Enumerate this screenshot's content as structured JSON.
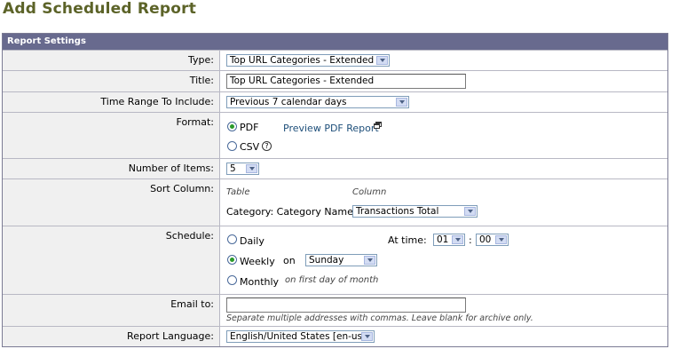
{
  "page": {
    "title": "Add Scheduled Report"
  },
  "panel": {
    "header": "Report Settings"
  },
  "labels": {
    "type": "Type:",
    "title": "Title:",
    "time_range": "Time Range To Include:",
    "format": "Format:",
    "number_of_items": "Number of Items:",
    "sort_column": "Sort Column:",
    "schedule": "Schedule:",
    "email_to": "Email to:",
    "report_language": "Report Language:"
  },
  "type": {
    "selected": "Top URL Categories - Extended"
  },
  "title_field": {
    "value": "Top URL Categories - Extended"
  },
  "time_range": {
    "selected": "Previous 7 calendar days"
  },
  "format": {
    "pdf_label": "PDF",
    "csv_label": "CSV",
    "selected": "PDF",
    "preview_link": "Preview PDF Report",
    "help_glyph": "?"
  },
  "number_of_items": {
    "selected": "5"
  },
  "sort_column": {
    "table_header": "Table",
    "column_header": "Column",
    "row_label": "Category: Category Name",
    "selected": "Transactions Total"
  },
  "schedule": {
    "daily_label": "Daily",
    "weekly_label": "Weekly",
    "monthly_label": "Monthly",
    "selected": "Weekly",
    "at_time_label": "At time:",
    "hour": "01",
    "colon": ":",
    "minute": "00",
    "on_label": "on",
    "day": "Sunday",
    "monthly_note": "on first day of month"
  },
  "email": {
    "value": "",
    "hint": "Separate multiple addresses with commas. Leave blank for archive only."
  },
  "language": {
    "selected": "English/United States [en-us]"
  },
  "colors": {
    "header_bg": "#686a8e",
    "title": "#5c6328",
    "link": "#1e4f7a",
    "radio_on": "#2a9a2a"
  }
}
